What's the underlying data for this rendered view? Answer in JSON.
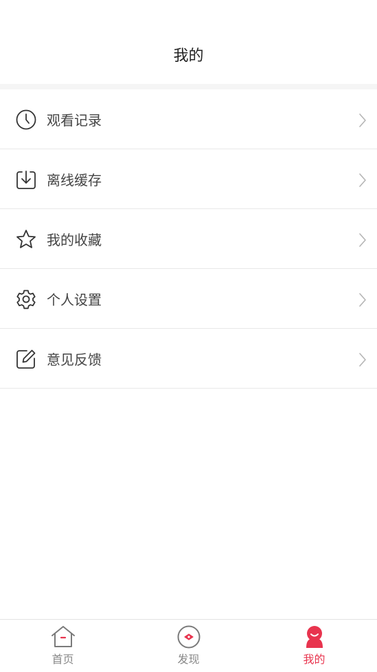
{
  "header": {
    "title": "我的"
  },
  "menu": {
    "items": [
      {
        "label": "观看记录",
        "icon": "clock-icon"
      },
      {
        "label": "离线缓存",
        "icon": "download-icon"
      },
      {
        "label": "我的收藏",
        "icon": "star-icon"
      },
      {
        "label": "个人设置",
        "icon": "gear-icon"
      },
      {
        "label": "意见反馈",
        "icon": "edit-icon"
      }
    ]
  },
  "tabbar": {
    "tabs": [
      {
        "label": "首页",
        "icon": "home-icon",
        "active": false
      },
      {
        "label": "发现",
        "icon": "discover-icon",
        "active": false
      },
      {
        "label": "我的",
        "icon": "profile-icon",
        "active": true
      }
    ]
  },
  "colors": {
    "accent": "#e8344e",
    "icon": "#333333",
    "inactive_tab": "#888888"
  }
}
